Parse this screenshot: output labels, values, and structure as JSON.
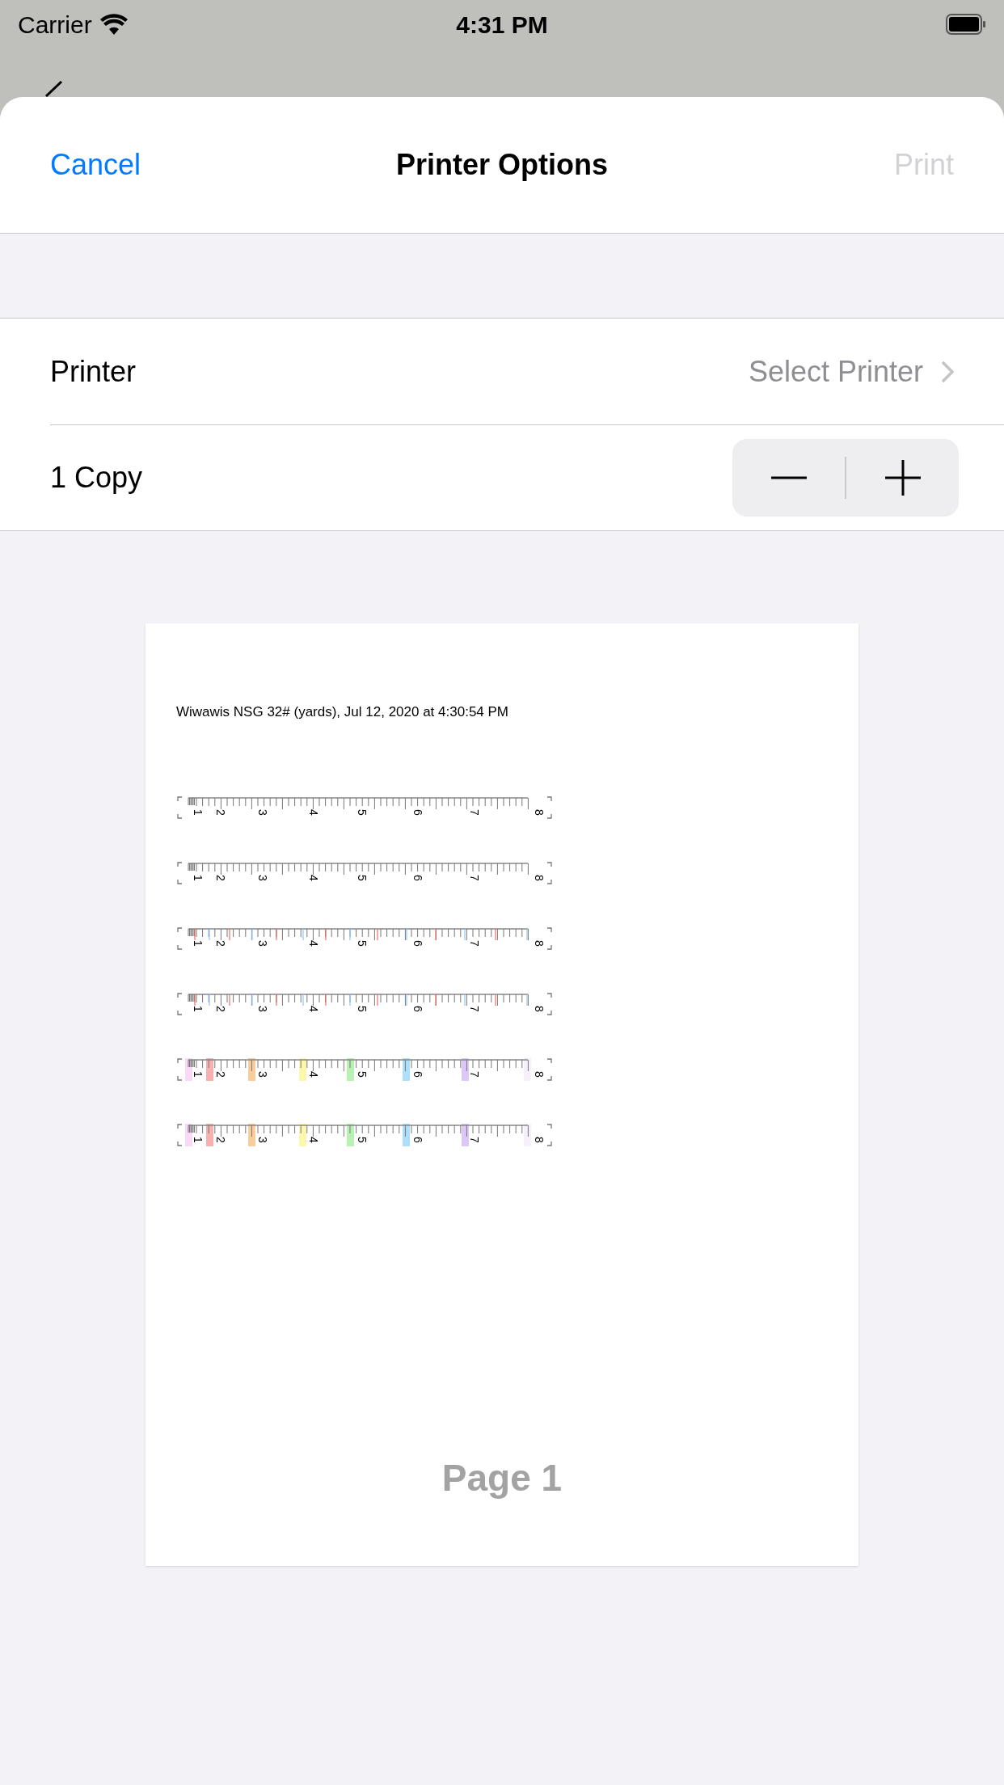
{
  "status_bar": {
    "carrier": "Carrier",
    "time": "4:31 PM"
  },
  "nav": {
    "cancel": "Cancel",
    "title": "Printer Options",
    "print": {
      "label": "Print",
      "disabled": true
    }
  },
  "rows": [
    {
      "kind": "link",
      "label": "Printer",
      "value": "Select Printer"
    },
    {
      "kind": "stepper",
      "label": "1 Copy"
    }
  ],
  "preview": {
    "heading": "Wiwawis NSG 32# (yards), Jul 12, 2020 at 4:30:54 PM",
    "rulers": [
      {
        "kind": "plain",
        "labels": [
          "1",
          "2",
          "3",
          "4",
          "5",
          "6",
          "7",
          "8"
        ]
      },
      {
        "kind": "plain",
        "labels": [
          "1",
          "2",
          "3",
          "4",
          "5",
          "6",
          "7",
          "8"
        ]
      },
      {
        "kind": "ticks",
        "labels": [
          "1",
          "2",
          "3",
          "4",
          "5",
          "6",
          "7",
          "8"
        ]
      },
      {
        "kind": "ticks",
        "labels": [
          "1",
          "2",
          "3",
          "4",
          "5",
          "6",
          "7",
          "8"
        ]
      },
      {
        "kind": "bands",
        "labels": [
          "1",
          "2",
          "3",
          "4",
          "5",
          "6",
          "7",
          "8"
        ]
      },
      {
        "kind": "bands",
        "labels": [
          "1",
          "2",
          "3",
          "4",
          "5",
          "6",
          "7",
          "8"
        ]
      }
    ],
    "page_label": "Page 1"
  }
}
